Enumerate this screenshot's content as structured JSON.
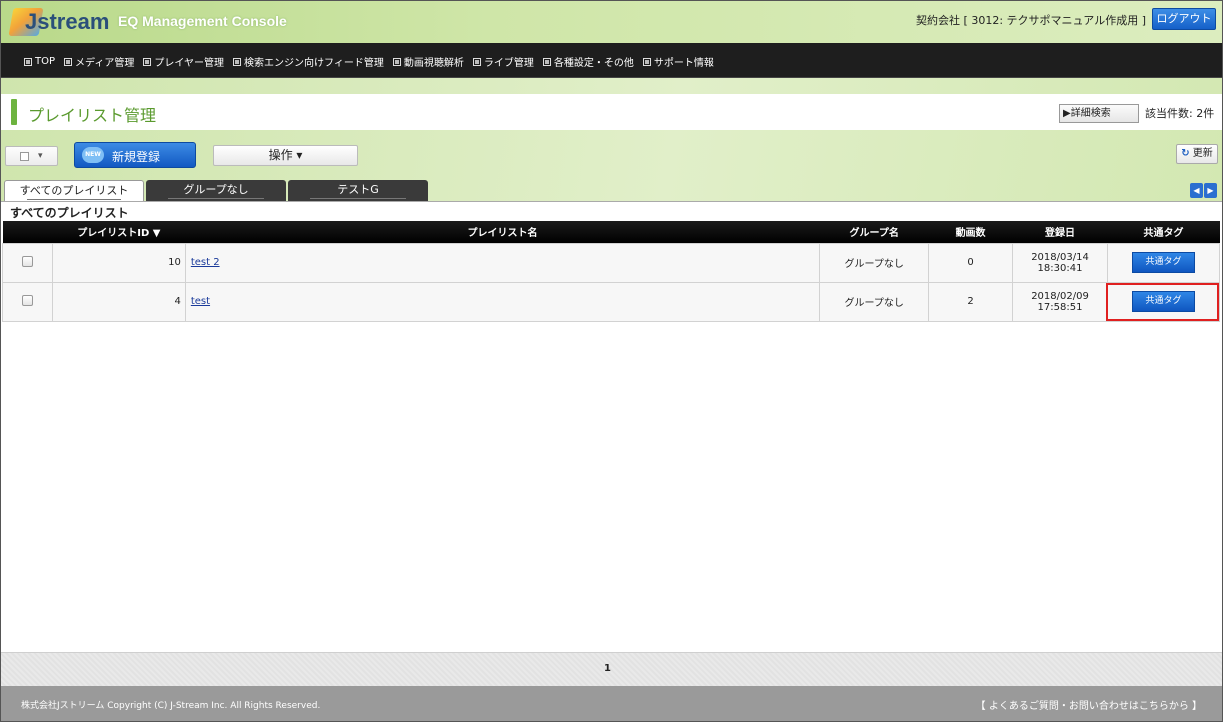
{
  "header": {
    "logo_text": "Jstream",
    "console_title": "EQ Management Console",
    "contract_text": "契約会社 [ 3012: テクサポマニュアル作成用 ]",
    "logout_label": "ログアウト"
  },
  "nav": {
    "items": [
      {
        "label": "TOP"
      },
      {
        "label": "メディア管理"
      },
      {
        "label": "プレイヤー管理"
      },
      {
        "label": "検索エンジン向けフィード管理"
      },
      {
        "label": "動画視聴解析"
      },
      {
        "label": "ライブ管理"
      },
      {
        "label": "各種設定・その他"
      },
      {
        "label": "サポート情報"
      }
    ]
  },
  "page": {
    "title": "プレイリスト管理",
    "detail_search_label": "▶詳細検索",
    "hit_count": "該当件数: 2件"
  },
  "toolbar": {
    "new_badge": "NEW",
    "new_label": "新規登録",
    "ops_label": "操作 ▾",
    "refresh_label": "更新",
    "select_arrow": "▾"
  },
  "tabs": [
    {
      "label": "すべてのプレイリスト"
    },
    {
      "label": "グループなし"
    },
    {
      "label": "テストG"
    }
  ],
  "list_heading": "すべてのプレイリスト",
  "table": {
    "columns": [
      "プレイリストID ▼",
      "プレイリスト名",
      "グループ名",
      "動画数",
      "登録日",
      "共通タグ"
    ],
    "rows": [
      {
        "id": "10",
        "name": "test 2",
        "group": "グループなし",
        "count": "0",
        "date": "2018/03/14",
        "time": "18:30:41",
        "tag": "共通タグ"
      },
      {
        "id": "4",
        "name": "test",
        "group": "グループなし",
        "count": "2",
        "date": "2018/02/09",
        "time": "17:58:51",
        "tag": "共通タグ"
      }
    ]
  },
  "pager": {
    "current": "1"
  },
  "footer": {
    "copyright": "株式会社Jストリーム Copyright (C) J-Stream Inc. All Rights Reserved.",
    "faq": "【 よくあるご質問・お問い合わせはこちらから 】"
  },
  "colors": {
    "accent_green": "#6db33f",
    "button_blue": "#1560c9",
    "highlight_red": "#e02020"
  }
}
